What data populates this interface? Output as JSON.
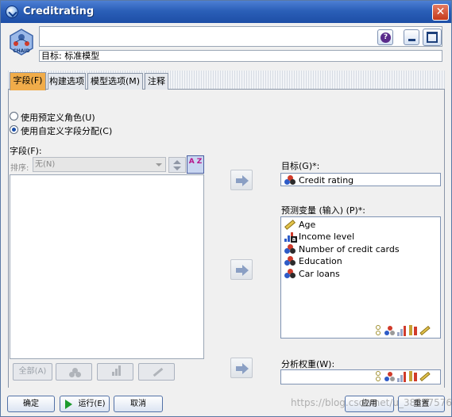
{
  "window": {
    "title": "Creditrating",
    "close_glyph": "✕"
  },
  "header": {
    "model_icon_label": "CHAID",
    "target_line": "目标: 标准模型",
    "help_glyph": "?"
  },
  "tabs": [
    {
      "label": "字段(F)",
      "active": true
    },
    {
      "label": "构建选项",
      "active": false
    },
    {
      "label": "模型选项(M)",
      "active": false
    },
    {
      "label": "注释",
      "active": false
    }
  ],
  "roles": {
    "predefined": "使用预定义角色(U)",
    "custom": "使用自定义字段分配(C)",
    "selected": "custom"
  },
  "fields_panel": {
    "label": "字段(F):",
    "sort_label": "排序:",
    "sort_value": "无(N)",
    "az_glyph": "A Z",
    "bottom_buttons": {
      "all": "全部(A)"
    }
  },
  "target": {
    "label": "目标(G)*:",
    "value": "Credit rating",
    "value_icon": "nominal-icon"
  },
  "predictors": {
    "label": "预测变量 (输入) (P)*:",
    "items": [
      {
        "label": "Age",
        "icon": "ruler-icon"
      },
      {
        "label": "Income level",
        "icon": "ordinal-icon"
      },
      {
        "label": "Number of credit cards",
        "icon": "nominal-icon"
      },
      {
        "label": "Education",
        "icon": "nominal-icon"
      },
      {
        "label": "Car loans",
        "icon": "nominal-icon"
      }
    ]
  },
  "weight": {
    "label": "分析权重(W):",
    "value": ""
  },
  "footer": {
    "ok": "确定",
    "run": "运行(E)",
    "cancel": "取消",
    "apply": "应用",
    "reset": "重置"
  },
  "watermark": "https://blog.csdn.net/u_38837576",
  "colors": {
    "title_bar": "#2b5fb8",
    "active_tab": "#f0ac4a",
    "close": "#c4391a"
  }
}
